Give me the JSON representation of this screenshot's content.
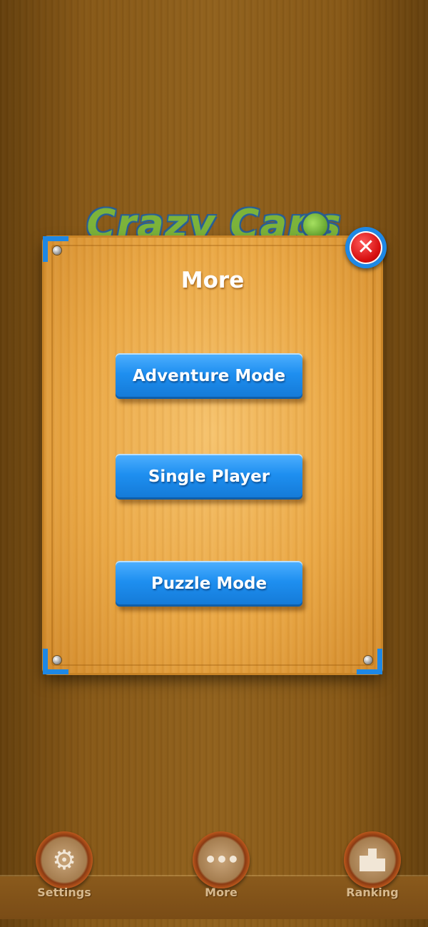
{
  "game": {
    "logo_text": "Crazy Caps"
  },
  "dialog": {
    "title": "More",
    "buttons": [
      {
        "label": "Adventure Mode"
      },
      {
        "label": "Single Player"
      },
      {
        "label": "Puzzle Mode"
      }
    ],
    "close_icon": "✕"
  },
  "bottom_nav": {
    "items": [
      {
        "label": "Settings",
        "icon": "gear-icon",
        "glyph": "⚙"
      },
      {
        "label": "More",
        "icon": "dots-icon",
        "glyph": "•••"
      },
      {
        "label": "Ranking",
        "icon": "podium-icon",
        "glyph": ""
      }
    ]
  },
  "colors": {
    "accent_blue": "#1e88e5",
    "close_red": "#d60f0f",
    "panel_wood": "#eaa743"
  }
}
